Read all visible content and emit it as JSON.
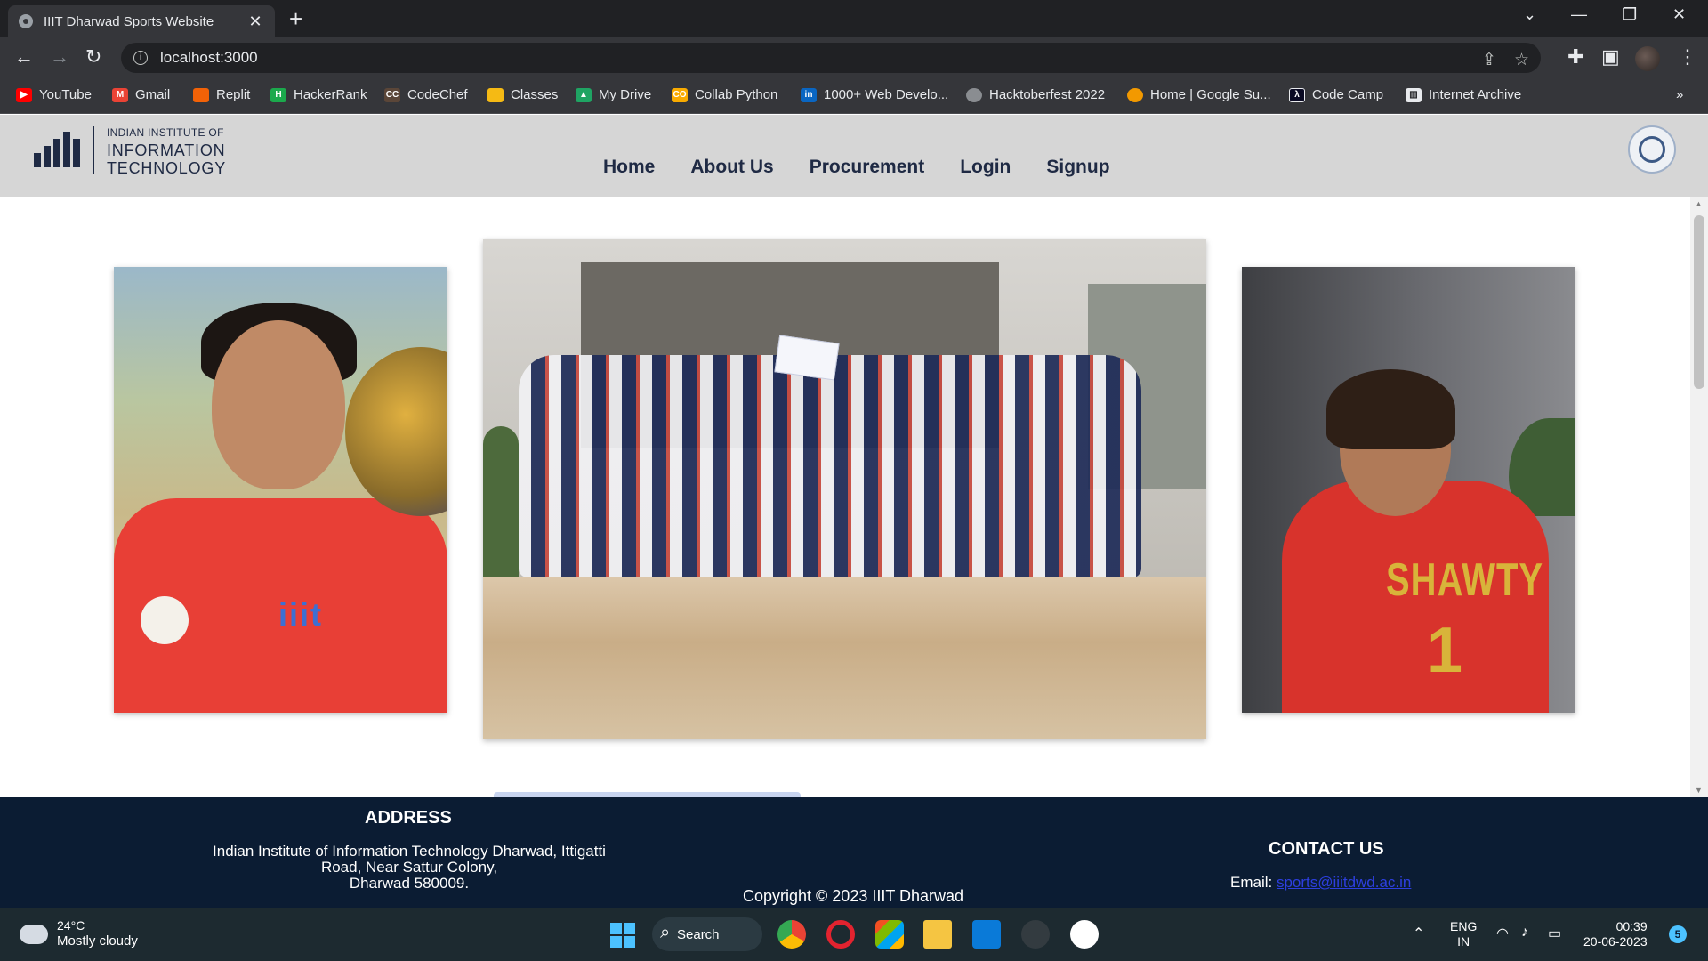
{
  "browser": {
    "tab_title": "IIIT Dharwad Sports Website",
    "tab_close": "✕",
    "new_tab": "+",
    "url": "localhost:3000",
    "bookmarks": [
      {
        "label": "YouTube",
        "color": "#ff0000"
      },
      {
        "label": "Gmail",
        "color": "#ea4335"
      },
      {
        "label": "Replit",
        "color": "#f26207"
      },
      {
        "label": "HackerRank",
        "color": "#1ba94c"
      },
      {
        "label": "CodeChef",
        "color": "#5b4638"
      },
      {
        "label": "Classes",
        "color": "#f5ba14"
      },
      {
        "label": "My Drive",
        "color": "#1fa463"
      },
      {
        "label": "Collab Python",
        "color": "#f9ab00"
      },
      {
        "label": "1000+ Web Develo...",
        "color": "#0a66c2"
      },
      {
        "label": "Hacktoberfest 2022",
        "color": "#8a8d91"
      },
      {
        "label": "Home | Google Su...",
        "color": "#f29900"
      },
      {
        "label": "Code Camp",
        "color": "#0a0a23"
      },
      {
        "label": "Internet Archive",
        "color": "#e8eaed"
      }
    ],
    "more_bookmarks": "»"
  },
  "site": {
    "logo": {
      "line1": "INDIAN INSTITUTE OF",
      "line2": "INFORMATION",
      "line3": "TECHNOLOGY"
    },
    "nav": [
      "Home",
      "About Us",
      "Procurement",
      "Login",
      "Signup"
    ],
    "photos": {
      "left_logo": "iiit",
      "right_name": "SHAWTY",
      "right_number": "1"
    }
  },
  "footer": {
    "address_title": "ADDRESS",
    "address_line1": "Indian Institute of Information Technology Dharwad, Ittigatti",
    "address_line2": "Road, Near Sattur Colony,",
    "address_line3": "Dharwad 580009.",
    "copyright": "Copyright © 2023 IIIT Dharwad",
    "contact_title": "CONTACT US",
    "email_label": "Email:",
    "email": "sports@iiitdwd.ac.in"
  },
  "taskbar": {
    "temperature": "24°C",
    "weather": "Mostly cloudy",
    "search": "Search",
    "lang1": "ENG",
    "lang2": "IN",
    "time": "00:39",
    "date": "20-06-2023",
    "notifications": "5"
  }
}
